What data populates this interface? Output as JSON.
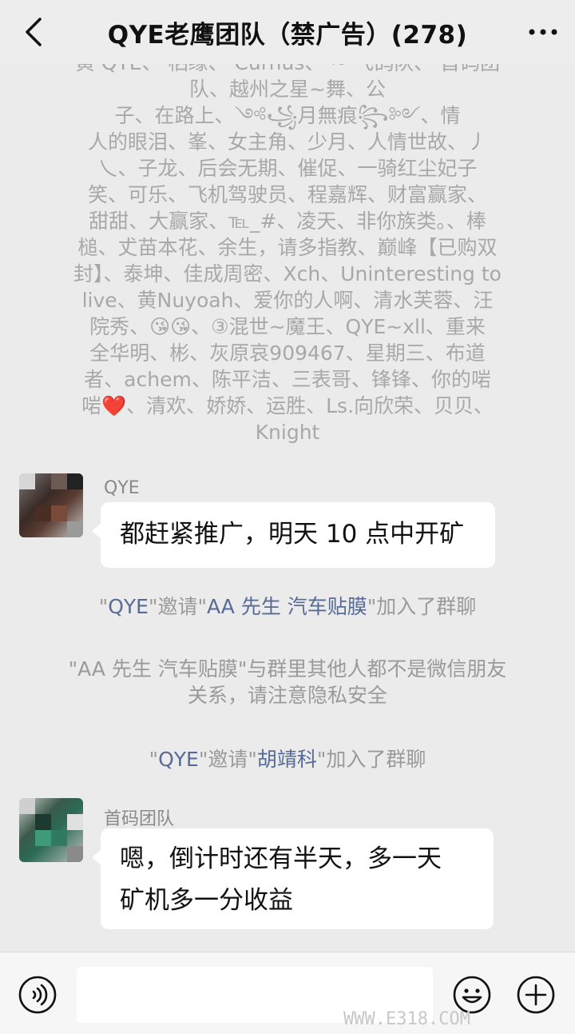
{
  "header": {
    "title": "QYE老鹰团队（禁广告）(278)"
  },
  "system_top": {
    "lines": [
      "黄 QYE、 栖缘、 Curnus、 ~ 飞鸽队、 首码团",
      "队、越州之星~舞、公",
      "子、在路上、༺꧁月無痕꧂༻、情",
      "人的眼泪、峯、女主角、少月、人情世故、丿",
      "乀、子龙、后会无期、催促、一骑红尘妃子",
      "笑、可乐、飞机驾驶员、程嘉辉、财富赢家、",
      "甜甜、大赢家、℡_#、凌天、非你族类。、棒",
      "槌、𠀋苗本花、余生，请多指教、巅峰【已购双",
      "封】、泰坤、佳成周密、Xch、Uninteresting to",
      "live、黄Nuyoah、爱你的人啊、清水芙蓉、汪",
      "院秀、😘😘、③混世~魔王、QYE~xll、重来",
      "全华明、彬、灰原哀909467、星期三、布道",
      "者、achem、陈平洁、三表哥、锋锋、你的啱",
      "啱❤️、清欢、娇娇、运胜、Ls.向欣荣、贝贝、",
      "Knight"
    ]
  },
  "messages": [
    {
      "sender": "QYE",
      "text": "都赶紧推广，明天 10 点中开矿"
    },
    {
      "sender": "首码团队",
      "line1": "嗯，倒计时还有半天，多一天",
      "line2": "矿机多一分收益"
    }
  ],
  "system_msgs": {
    "invite1": {
      "q1": "\"",
      "inviter": "QYE",
      "mid": "\"邀请\"",
      "invitee": "AA 先生 汽车贴膜",
      "tail": "\"加入了群聊"
    },
    "notice_line1": "\"AA 先生 汽车贴膜\"与群里其他人都不是微信朋友",
    "notice_line2": "关系，请注意隐私安全",
    "invite2": {
      "q1": "\"",
      "inviter": "QYE",
      "mid": "\"邀请\"",
      "invitee": "胡靖科",
      "tail": "\"加入了群聊"
    }
  },
  "input": {
    "value": ""
  },
  "watermark": "WWW.E318.COM",
  "colors": {
    "background": "#ebebeb",
    "link": "#576b95",
    "system_text": "#9a9a9a"
  }
}
